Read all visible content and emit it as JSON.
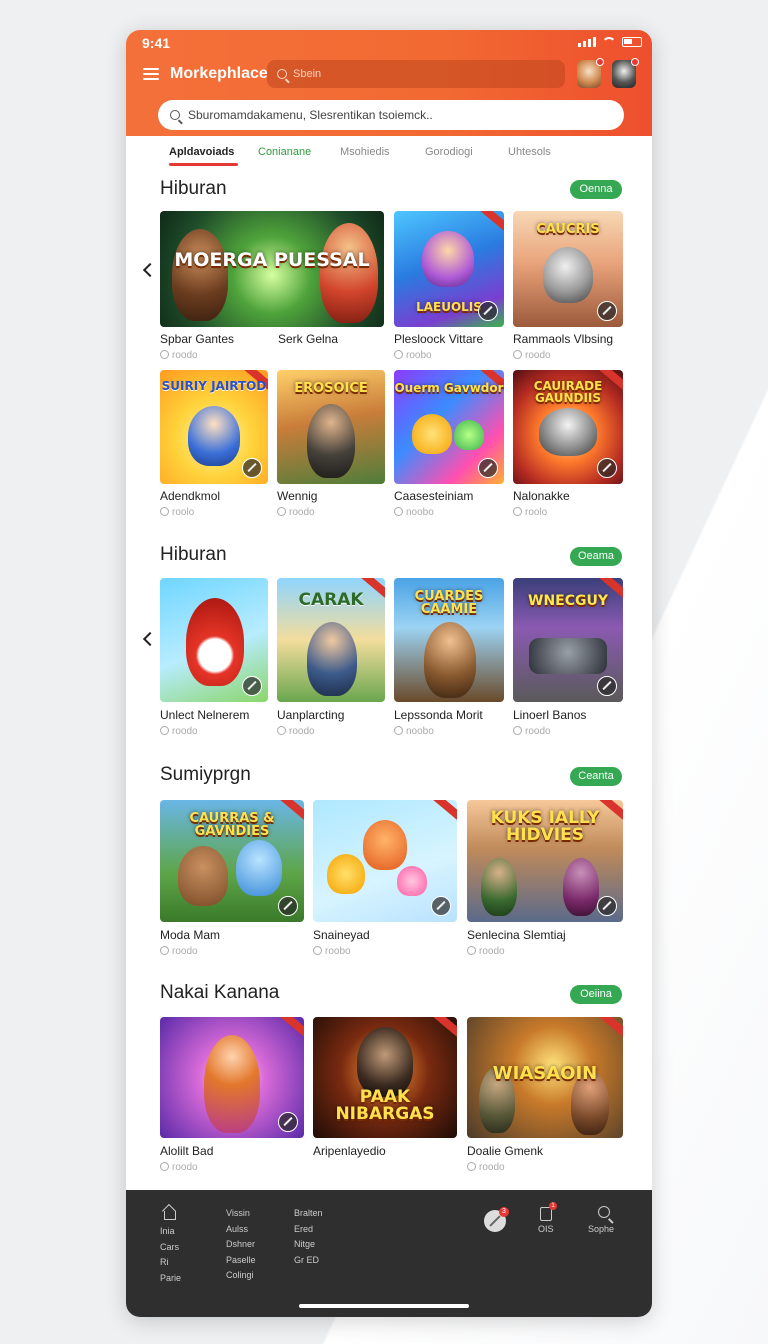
{
  "status": {
    "time": "9:41"
  },
  "header": {
    "title": "Morkephlace",
    "top_search_placeholder": "Sbein",
    "search_placeholder": "Sburomamdakamenu, Slesrentikan tsoiemck.."
  },
  "tabs": [
    {
      "label": "Apldavoiads",
      "active": true
    },
    {
      "label": "Conianane",
      "color": "#2e9d3e"
    },
    {
      "label": "Msohiedis"
    },
    {
      "label": "Gorodiogi"
    },
    {
      "label": "Uhtesols"
    }
  ],
  "sections": [
    {
      "title": "Hiburan",
      "action": "Oenna",
      "cards": [
        {
          "name": "Spbar Gantes",
          "sub": "roodo",
          "art": "MOERGA PUESSAL",
          "icon": "adventure-game-art"
        },
        {
          "name": "Serk Gelna",
          "sub": "",
          "art": "",
          "icon": ""
        },
        {
          "name": "Plesloock Vittare",
          "sub": "roobo",
          "art": "LAEUOLIS",
          "icon": "fantasy-game-art"
        },
        {
          "name": "Rammaols Vlbsing",
          "sub": "roodo",
          "art": "CAUCRIS",
          "icon": "robot-game-art"
        },
        {
          "name": "Adendkmol",
          "sub": "roolo",
          "art": "SUIRIY JAIRTOD",
          "icon": "cartoon-game-art"
        },
        {
          "name": "Wennig",
          "sub": "roodo",
          "art": "EROSOICE",
          "icon": "action-game-art"
        },
        {
          "name": "Caasesteiniam",
          "sub": "noobo",
          "art": "Ouerm Gavwdor",
          "icon": "puzzle-game-art"
        },
        {
          "name": "Nalonakke",
          "sub": "roolo",
          "art": "CAUIRADE GAUNDIIS",
          "icon": "shooter-game-art"
        }
      ]
    },
    {
      "title": "Hiburan",
      "action": "Oeama",
      "cards": [
        {
          "name": "Unlect Nelnerem",
          "sub": "roodo",
          "art": "",
          "icon": "mascot-game-art"
        },
        {
          "name": "Uanplarcting",
          "sub": "roodo",
          "art": "CARAK",
          "icon": "crew-game-art"
        },
        {
          "name": "Lepssonda Morit",
          "sub": "noobo",
          "art": "CUARDES CAAMIE",
          "icon": "explorer-game-art"
        },
        {
          "name": "Linoerl Banos",
          "sub": "roodo",
          "art": "WNECGUY",
          "icon": "racing-game-art"
        }
      ]
    },
    {
      "title": "Sumiyprgn",
      "action": "Ceanta",
      "cards": [
        {
          "name": "Moda Mam",
          "sub": "roodo",
          "art": "CAURRAS & GAVNDIES",
          "icon": "creature-game-art"
        },
        {
          "name": "Snaineyad",
          "sub": "roobo",
          "art": "",
          "icon": "candy-game-art"
        },
        {
          "name": "Senlecina Slemtiaj",
          "sub": "roodo",
          "art": "KUKS IALLY HIDVIES",
          "icon": "army-game-art"
        }
      ]
    },
    {
      "title": "Nakai Kanana",
      "action": "Oeiina",
      "cards": [
        {
          "name": "Alolilt Bad",
          "sub": "roodo",
          "art": "",
          "icon": "heroine-game-art"
        },
        {
          "name": "Aripenlayedio",
          "sub": "",
          "art": "PAAK NIBARGAS",
          "icon": "western-game-art"
        },
        {
          "name": "Doalie Gmenk",
          "sub": "roodo",
          "art": "WIASAOIN",
          "icon": "war-game-art"
        }
      ]
    }
  ],
  "bottom_bar": {
    "col1": [
      "Inia",
      "Cars",
      "Ri",
      "Parie"
    ],
    "col2": [
      "Vissin",
      "Aulss",
      "Dshner",
      "Paselle",
      "Colingi"
    ],
    "col3": [
      "Bralten",
      "Ered",
      "Nitge",
      "Gr ED"
    ],
    "game_badge": "3",
    "bag_badge": "1",
    "bag_label": "OIS",
    "search_label": "Sophe"
  }
}
